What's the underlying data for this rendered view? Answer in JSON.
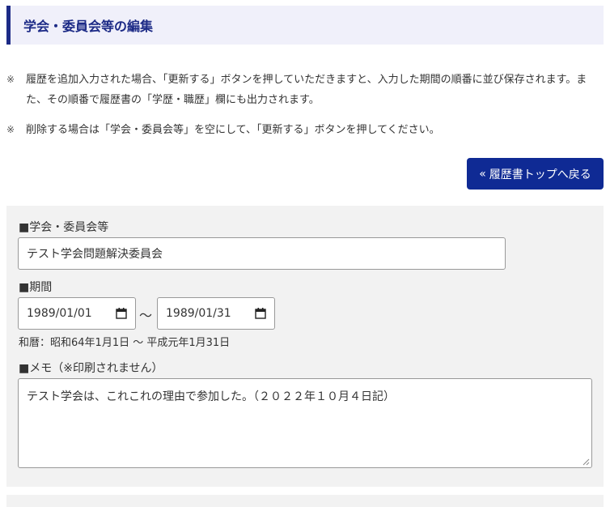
{
  "header": {
    "title": "学会・委員会等の編集"
  },
  "notes": [
    {
      "mark": "※",
      "text": "履歴を追加入力された場合、「更新する」ボタンを押していただきますと、入力した期間の順番に並び保存されます。また、その順番で履歴書の「学歴・職歴」欄にも出力されます。"
    },
    {
      "mark": "※",
      "text": "削除する場合は「学会・委員会等」を空にして、「更新する」ボタンを押してください。"
    }
  ],
  "back_button": {
    "chevron": "«",
    "label": "履歴書トップへ戻る"
  },
  "form": {
    "committee": {
      "label": "■学会・委員会等",
      "value": "テスト学会問題解決委員会"
    },
    "period": {
      "label": "■期間",
      "start": "1989/01/01",
      "separator": "～",
      "end": "1989/01/31",
      "era_text": "和暦：昭和64年1月1日 ～ 平成元年1月31日"
    },
    "memo": {
      "label": "■メモ（※印刷されません）",
      "value": "テスト学会は、これこれの理由で参加した。（２０２２年１０月４日記）"
    }
  },
  "icons": {
    "calendar": "calendar-icon",
    "resize": "resize-grip-icon"
  },
  "colors": {
    "accent": "#1c2a86",
    "button": "#0f2a94",
    "panel": "#f2f2f2",
    "header_bg": "#f0f0fa"
  }
}
